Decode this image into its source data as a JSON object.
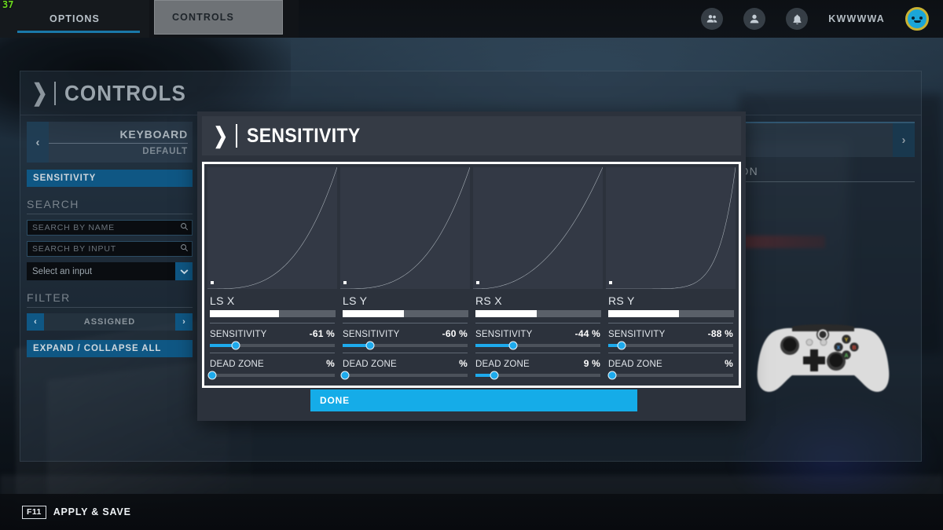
{
  "fps_counter": "37",
  "topbar": {
    "tabs": [
      {
        "label": "OPTIONS",
        "state": "active"
      },
      {
        "label": "CONTROLS",
        "state": "selected"
      }
    ],
    "icons": [
      {
        "name": "friends-icon",
        "glyph": "👥"
      },
      {
        "name": "profile-icon",
        "glyph": "👤"
      },
      {
        "name": "notification-bell-icon",
        "glyph": "🔔"
      }
    ],
    "username": "KWWWWA"
  },
  "page": {
    "title": "CONTROLS"
  },
  "sidebar": {
    "device": {
      "name": "KEYBOARD",
      "preset": "DEFAULT",
      "prev_arrow": "‹"
    },
    "sensitivity_item": "SENSITIVITY",
    "search": {
      "section_label": "SEARCH",
      "by_name_placeholder": "SEARCH BY NAME",
      "by_name_value": "",
      "by_input_placeholder": "SEARCH BY INPUT",
      "by_input_value": "",
      "select_value": "Select an input",
      "select_arrow": "❯"
    },
    "filter": {
      "section_label": "FILTER",
      "value": "ASSIGNED",
      "prev_arrow": "‹",
      "next_arrow": "›"
    },
    "expand_collapse": "EXPAND / COLLAPSE ALL"
  },
  "right_column": {
    "next_arrow": "›",
    "description_label": "DESCRIPTION"
  },
  "dialog": {
    "title": "SENSITIVITY",
    "done_label": "DONE",
    "cards": [
      {
        "name": "LS X",
        "bar_fill_percent": 55,
        "sensitivity": {
          "label": "SENSITIVITY",
          "value": "-61",
          "unit": "%",
          "slider_percent": 21
        },
        "dead_zone": {
          "label": "DEAD ZONE",
          "value": "",
          "unit": "%",
          "slider_percent": 2
        },
        "curve_exponent": 3.2
      },
      {
        "name": "LS Y",
        "bar_fill_percent": 49,
        "sensitivity": {
          "label": "SENSITIVITY",
          "value": "-60",
          "unit": "%",
          "slider_percent": 22
        },
        "dead_zone": {
          "label": "DEAD ZONE",
          "value": "",
          "unit": "%",
          "slider_percent": 2
        },
        "curve_exponent": 3.1
      },
      {
        "name": "RS X",
        "bar_fill_percent": 49,
        "sensitivity": {
          "label": "SENSITIVITY",
          "value": "-44",
          "unit": "%",
          "slider_percent": 30
        },
        "dead_zone": {
          "label": "DEAD ZONE",
          "value": "9",
          "unit": "%",
          "slider_percent": 15
        },
        "curve_exponent": 2.4
      },
      {
        "name": "RS Y",
        "bar_fill_percent": 56,
        "sensitivity": {
          "label": "SENSITIVITY",
          "value": "-88",
          "unit": "%",
          "slider_percent": 11
        },
        "dead_zone": {
          "label": "DEAD ZONE",
          "value": "",
          "unit": "%",
          "slider_percent": 3
        },
        "curve_exponent": 8.0
      }
    ]
  },
  "bottombar": {
    "key": "F11",
    "action": "APPLY & SAVE"
  },
  "colors": {
    "accent_blue": "#15ace8",
    "panel_blue": "#0f5784",
    "dialog_bg": "#2c323c",
    "graph_bg": "#333945",
    "fps_green": "#6cdb1f"
  }
}
